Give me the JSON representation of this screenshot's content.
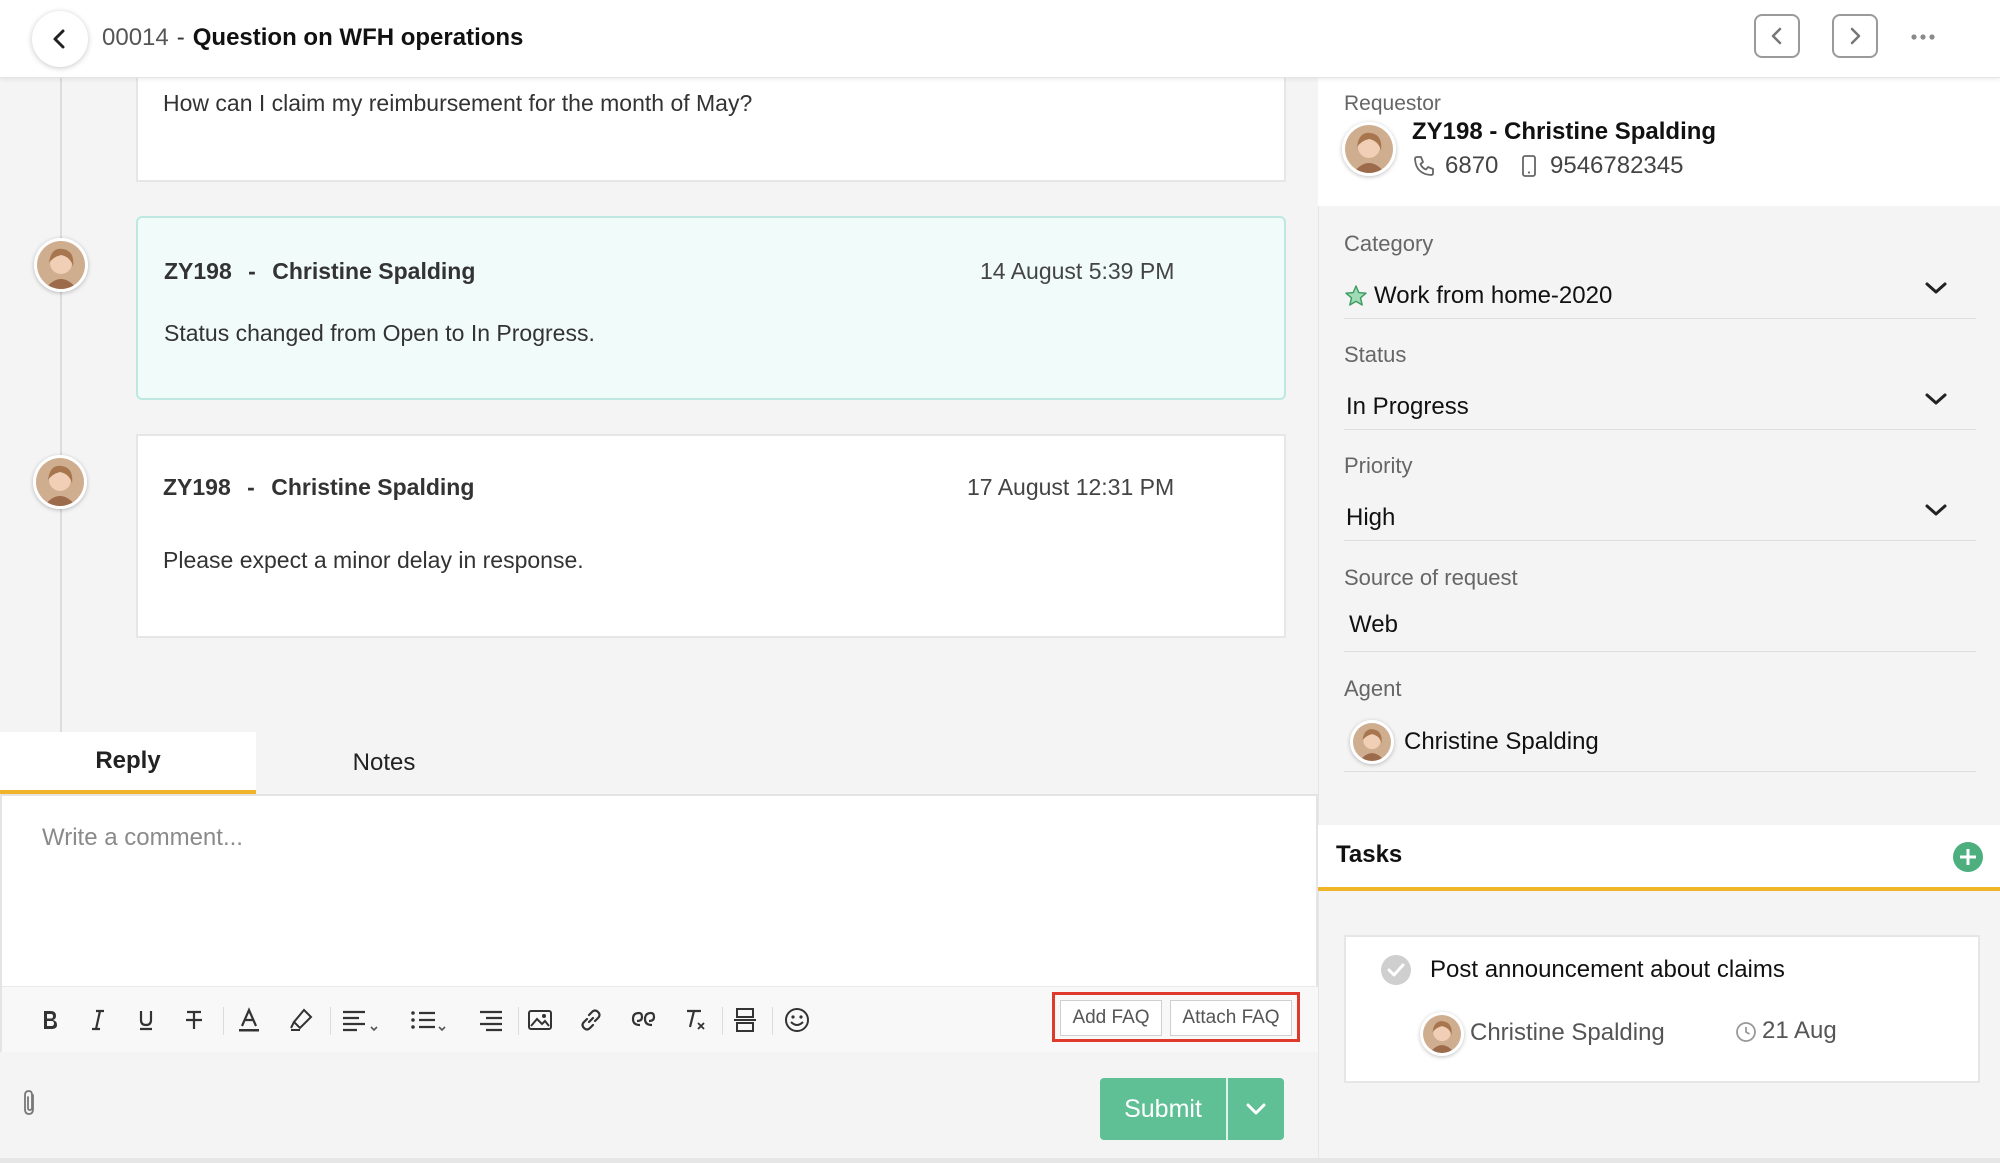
{
  "header": {
    "ticket_id": "00014",
    "separator": "-",
    "title": "Question on WFH operations"
  },
  "conversation": {
    "first_message": "How can I claim my reimbursement for the month of May?",
    "events": [
      {
        "author_id": "ZY198",
        "author_separator": "-",
        "author_name": "Christine Spalding",
        "time": "14 August 5:39 PM",
        "text": "Status changed from Open to In Progress."
      },
      {
        "author_id": "ZY198",
        "author_separator": "-",
        "author_name": "Christine Spalding",
        "time": "17 August 12:31 PM",
        "text": "Please expect a minor delay in response."
      }
    ]
  },
  "reply": {
    "tabs": [
      "Reply",
      "Notes"
    ],
    "active_tab": "Reply",
    "placeholder": "Write a comment...",
    "add_faq": "Add FAQ",
    "attach_faq": "Attach FAQ",
    "submit": "Submit"
  },
  "sidebar": {
    "requestor_label": "Requestor",
    "requestor_name": "ZY198 - Christine Spalding",
    "extension": "6870",
    "mobile": "9546782345",
    "category_label": "Category",
    "category_value": "Work from home-2020",
    "status_label": "Status",
    "status_value": "In Progress",
    "priority_label": "Priority",
    "priority_value": "High",
    "source_label": "Source of request",
    "source_value": "Web",
    "agent_label": "Agent",
    "agent_value": "Christine Spalding",
    "tasks_title": "Tasks",
    "task": {
      "title": "Post announcement about claims",
      "assignee": "Christine Spalding",
      "due": "21 Aug"
    }
  },
  "colors": {
    "accent": "#f0b429",
    "submit": "#5fbf95",
    "highlight_border": "#e03a2f",
    "add_task": "#4caf7d"
  },
  "icons": {
    "back": "chevron-left-icon",
    "prev": "chevron-left-icon",
    "next": "chevron-right-icon",
    "more": "more-horizontal-icon",
    "phone": "phone-icon",
    "mobile": "mobile-icon",
    "category": "star-icon",
    "add_task": "plus-circle-icon",
    "task_done": "check-circle-icon",
    "due": "clock-icon",
    "attach": "paperclip-icon"
  }
}
